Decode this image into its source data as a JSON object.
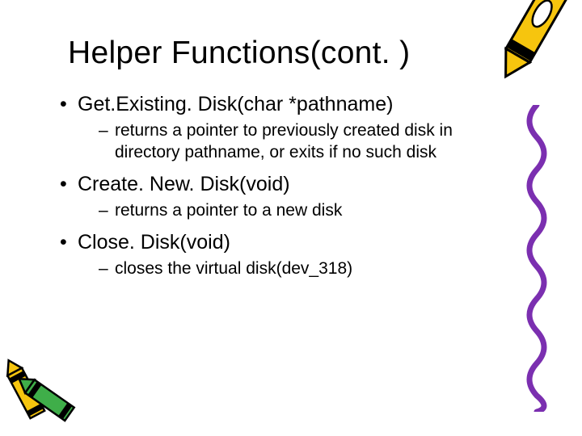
{
  "title": "Helper Functions(cont. )",
  "bullets": [
    {
      "text": "Get.Existing. Disk(char *pathname)",
      "sub": [
        "returns a pointer to previously created disk in directory pathname, or exits if no such disk"
      ]
    },
    {
      "text": "Create. New. Disk(void)",
      "sub": [
        "returns a pointer to a new disk"
      ]
    },
    {
      "text": "Close. Disk(void)",
      "sub": [
        "closes the virtual disk(dev_318)"
      ]
    }
  ]
}
